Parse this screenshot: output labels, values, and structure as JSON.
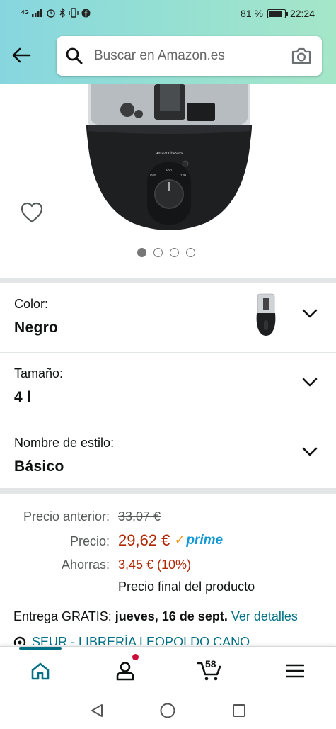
{
  "status_bar": {
    "network": "4G",
    "battery_percent": "81 %",
    "battery_level": 0.81,
    "time": "22:24"
  },
  "header": {
    "back_icon": "arrow-left-icon",
    "search": {
      "placeholder": "Buscar en Amazon.es",
      "value": ""
    },
    "camera_icon": "camera-icon"
  },
  "gallery": {
    "image_count": 4,
    "active_index": 0,
    "product_brand": "amazonbasics",
    "dial_labels": [
      "OFF",
      "2AH",
      "12H"
    ]
  },
  "variations": [
    {
      "label": "Color:",
      "value": "Negro"
    },
    {
      "label": "Tamaño:",
      "value": "4 l"
    },
    {
      "label": "Nombre de estilo:",
      "value": "Básico"
    }
  ],
  "price": {
    "previous_label": "Precio anterior:",
    "previous_value": "33,07 €",
    "price_label": "Precio:",
    "price_value": "29,62 €",
    "prime_check": "✓",
    "prime_text": "prime",
    "savings_label": "Ahorras:",
    "savings_value": "3,45 € (10%)",
    "final_note": "Precio final del producto"
  },
  "delivery": {
    "prefix": "Entrega GRATIS:",
    "date": "jueves, 16 de sept.",
    "link": "Ver detalles"
  },
  "seller_partial": "SEUR - LIBRERÍA LEOPOLDO CANO",
  "bottom_nav": {
    "cart_count": "58",
    "account_has_notification": true
  },
  "colors": {
    "header_gradient_start": "#87d6df",
    "header_gradient_end": "#a5e6c8",
    "price_red": "#b12704",
    "link_teal": "#007185",
    "prime_blue": "#1399d6",
    "notification_red": "#cc0c39"
  }
}
